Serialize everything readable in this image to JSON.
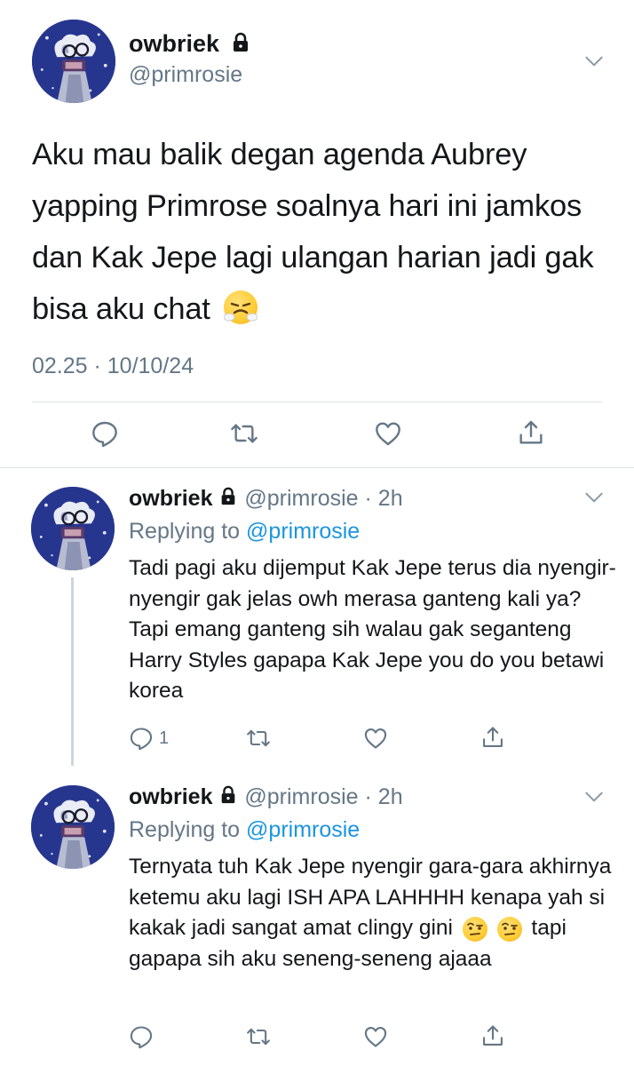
{
  "main_tweet": {
    "display_name": "owbriek",
    "handle": "@primrosie",
    "text": "Aku mau balik degan agenda Aubrey yapping Primrose soalnya hari ini jamkos dan Kak Jepe lagi ulangan harian jadi gak bisa aku chat",
    "emoji": "😤",
    "timestamp": "02.25 · 10/10/24"
  },
  "replies": [
    {
      "display_name": "owbriek",
      "handle": "@primrosie",
      "age": "· 2h",
      "replying_prefix": "Replying to",
      "replying_handle": "@primrosie",
      "text": "Tadi pagi aku dijemput Kak Jepe terus dia nyengir-nyengir gak jelas owh merasa ganteng kali ya? Tapi emang ganteng sih walau gak seganteng Harry Styles gapapa Kak Jepe you do you betawi korea",
      "reply_count": "1"
    },
    {
      "display_name": "owbriek",
      "handle": "@primrosie",
      "age": "· 2h",
      "replying_prefix": "Replying to",
      "replying_handle": "@primrosie",
      "text_part1": "Ternyata tuh Kak Jepe nyengir gara-gara akhirnya ketemu aku lagi ISH APA LAHHHH kenapa yah si kakak jadi sangat amat clingy gini",
      "emoji": "🤨🤨",
      "text_part2": "tapi gapapa sih aku seneng-seneng ajaaa",
      "reply_count": ""
    }
  ],
  "icons": {
    "reply": "reply-icon",
    "retweet": "retweet-icon",
    "like": "heart-icon",
    "share": "share-icon",
    "lock": "lock-icon",
    "more": "chevron-down-icon"
  },
  "colors": {
    "text": "#14171a",
    "secondary": "#657786",
    "link": "#1b95e0",
    "thread_line": "#ccd6dd",
    "divider": "#dfe3e6"
  }
}
